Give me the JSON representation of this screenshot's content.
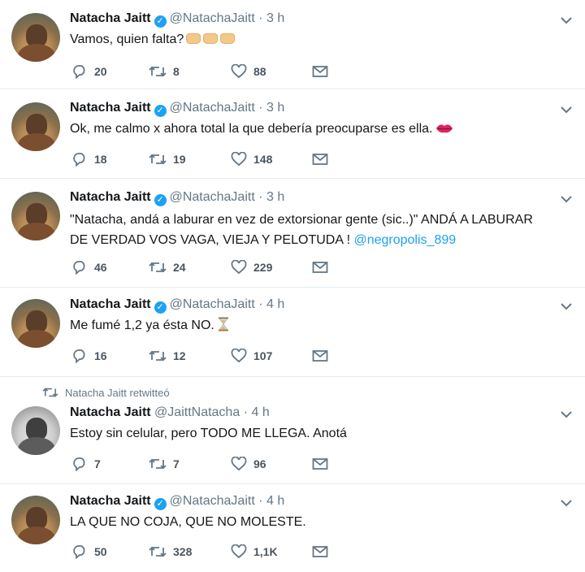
{
  "retweet_notice": "Natacha Jaitt retwitteó",
  "tweets": [
    {
      "name": "Natacha Jaitt",
      "verified": true,
      "handle": "@NatachaJaitt",
      "separator": "·",
      "time": "3 h",
      "text": "Vamos, quien falta?",
      "emoji": "oncoming-fist-emoji x3",
      "replies": "20",
      "retweets": "8",
      "likes": "88"
    },
    {
      "name": "Natacha Jaitt",
      "verified": true,
      "handle": "@NatachaJaitt",
      "separator": "·",
      "time": "3 h",
      "text": "Ok, me calmo x ahora total la que debería preocuparse es ella.",
      "emoji": "kiss-mark-emoji",
      "replies": "18",
      "retweets": "19",
      "likes": "148"
    },
    {
      "name": "Natacha Jaitt",
      "verified": true,
      "handle": "@NatachaJaitt",
      "separator": "·",
      "time": "3 h",
      "text_line1": "\"Natacha, andá a laburar en vez de extorsionar gente (sic..)\" ANDÁ A LABURAR",
      "text_line2": "DE VERDAD VOS VAGA, VIEJA Y PELOTUDA !",
      "mention": "@negropolis_899",
      "replies": "46",
      "retweets": "24",
      "likes": "229"
    },
    {
      "name": "Natacha Jaitt",
      "verified": true,
      "handle": "@NatachaJaitt",
      "separator": "·",
      "time": "4 h",
      "text": "Me fumé 1,2 ya ésta NO.",
      "emoji": "hourglass-emoji",
      "replies": "16",
      "retweets": "12",
      "likes": "107"
    },
    {
      "name": "Natacha Jaitt",
      "verified": false,
      "handle": "@JaittNatacha",
      "separator": "·",
      "time": "4 h",
      "text": "Estoy sin celular, pero TODO ME LLEGA. Anotá",
      "replies": "7",
      "retweets": "7",
      "likes": "96"
    },
    {
      "name": "Natacha Jaitt",
      "verified": true,
      "handle": "@NatachaJaitt",
      "separator": "·",
      "time": "4 h",
      "text": "LA QUE NO COJA, QUE NO MOLESTE.",
      "replies": "50",
      "retweets": "328",
      "likes": "1,1K"
    }
  ],
  "colors": {
    "link_blue": "#1da1f2",
    "meta_gray": "#657786",
    "text_dark": "#14171a",
    "divider": "#e6ecf0"
  },
  "icons": [
    "reply-icon",
    "retweet-icon",
    "like-icon",
    "direct-message-icon",
    "chevron-down-icon",
    "verified-badge-icon"
  ]
}
